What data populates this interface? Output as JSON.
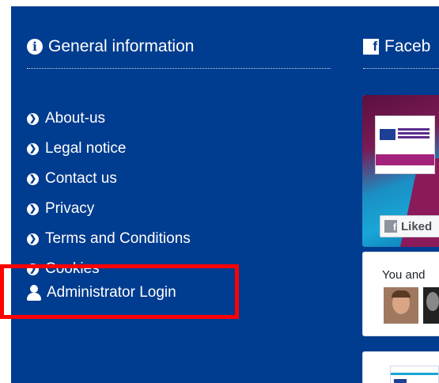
{
  "general": {
    "title": "General information",
    "links": [
      "About-us",
      "Legal notice",
      "Contact us",
      "Privacy",
      "Terms and Conditions",
      "Cookies"
    ],
    "admin_login": "Administrator Login"
  },
  "facebook": {
    "title": "Faceb",
    "like_label": "Liked",
    "friends_text": "You and"
  },
  "colors": {
    "panel": "#003c8f",
    "highlight": "#ff0000"
  },
  "icons": {
    "info": "info-circle-icon",
    "facebook": "facebook-icon",
    "link": "chevron-circle-right-icon",
    "user": "user-icon"
  }
}
